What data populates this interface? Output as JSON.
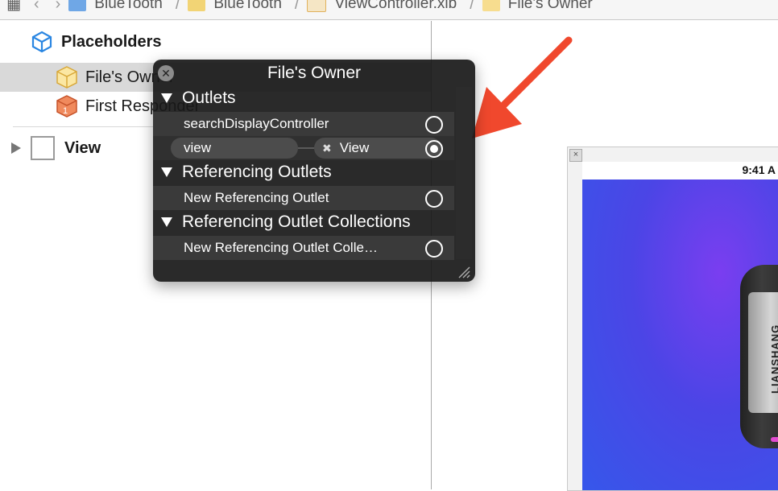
{
  "jumpbar": {
    "items": [
      {
        "label": "BlueTooth",
        "icon": "project-icon"
      },
      {
        "label": "BlueTooth",
        "icon": "folder-icon"
      },
      {
        "label": "ViewController.xib",
        "icon": "xib-file-icon"
      },
      {
        "label": "File's Owner",
        "icon": "placeholder-cube-icon"
      }
    ]
  },
  "outline": {
    "placeholders_label": "Placeholders",
    "files_owner_label": "File's Owner",
    "first_responder_label": "First Responder",
    "view_label": "View"
  },
  "canvas": {
    "status_time": "9:41 A",
    "speaker_logo": "LIANSHANG"
  },
  "hud": {
    "title": "File's Owner",
    "outlets_label": "Outlets",
    "outlet_rows": [
      {
        "label": "searchDisplayController"
      }
    ],
    "connected_outlet": {
      "label": "view",
      "target": "View"
    },
    "referencing_outlets_label": "Referencing Outlets",
    "new_referencing_outlet": "New Referencing Outlet",
    "referencing_collections_label": "Referencing Outlet Collections",
    "new_referencing_collection": "New Referencing Outlet Colle…"
  },
  "colors": {
    "annotation_arrow": "#f0482d",
    "hud_background": "#181818",
    "selection": "#d9d9d9"
  }
}
